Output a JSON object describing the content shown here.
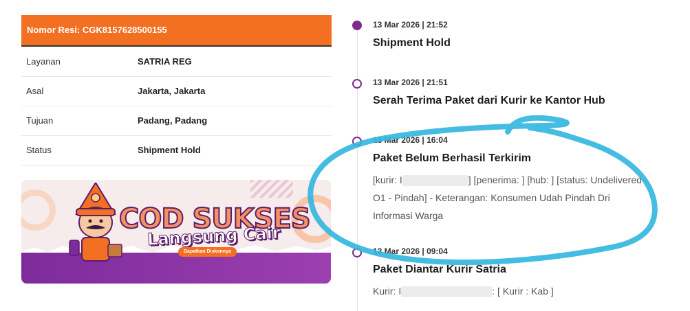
{
  "shipment": {
    "resi_label": "Nomor Resi: CGK8157628500155",
    "rows": [
      {
        "label": "Layanan",
        "value": "SATRIA REG"
      },
      {
        "label": "Asal",
        "value": "Jakarta, Jakarta"
      },
      {
        "label": "Tujuan",
        "value": "Padang, Padang"
      },
      {
        "label": "Status",
        "value": "Shipment Hold"
      }
    ]
  },
  "banner": {
    "title": "COD SUKSES",
    "subtitle": "Langsung Cair",
    "cta": "Dapatkan Diskonnya"
  },
  "timeline": [
    {
      "time": "13 Mar 2026 | 21:52",
      "title": "Shipment Hold",
      "active": true
    },
    {
      "time": "13 Mar 2026 | 21:51",
      "title": "Serah Terima Paket dari Kurir ke Kantor Hub"
    },
    {
      "time": "13 Mar 2026 | 16:04",
      "title": "Paket Belum Berhasil Terkirim",
      "desc_a": "[kurir: I",
      "desc_b": "] [penerima: ] [hub: ] [status: Undelivered - O1 - Pindah] - Keterangan: Konsumen Udah Pindah Dri Informasi Warga"
    },
    {
      "time": "13 Mar 2026 | 09:04",
      "title": "Paket Diantar Kurir Satria",
      "desc_a": "Kurir: I",
      "desc_b": ": [ Kurir : Kab ]"
    }
  ],
  "colors": {
    "accent": "#f36f21",
    "purple": "#7d2b8f",
    "scribble": "#35b6de"
  }
}
